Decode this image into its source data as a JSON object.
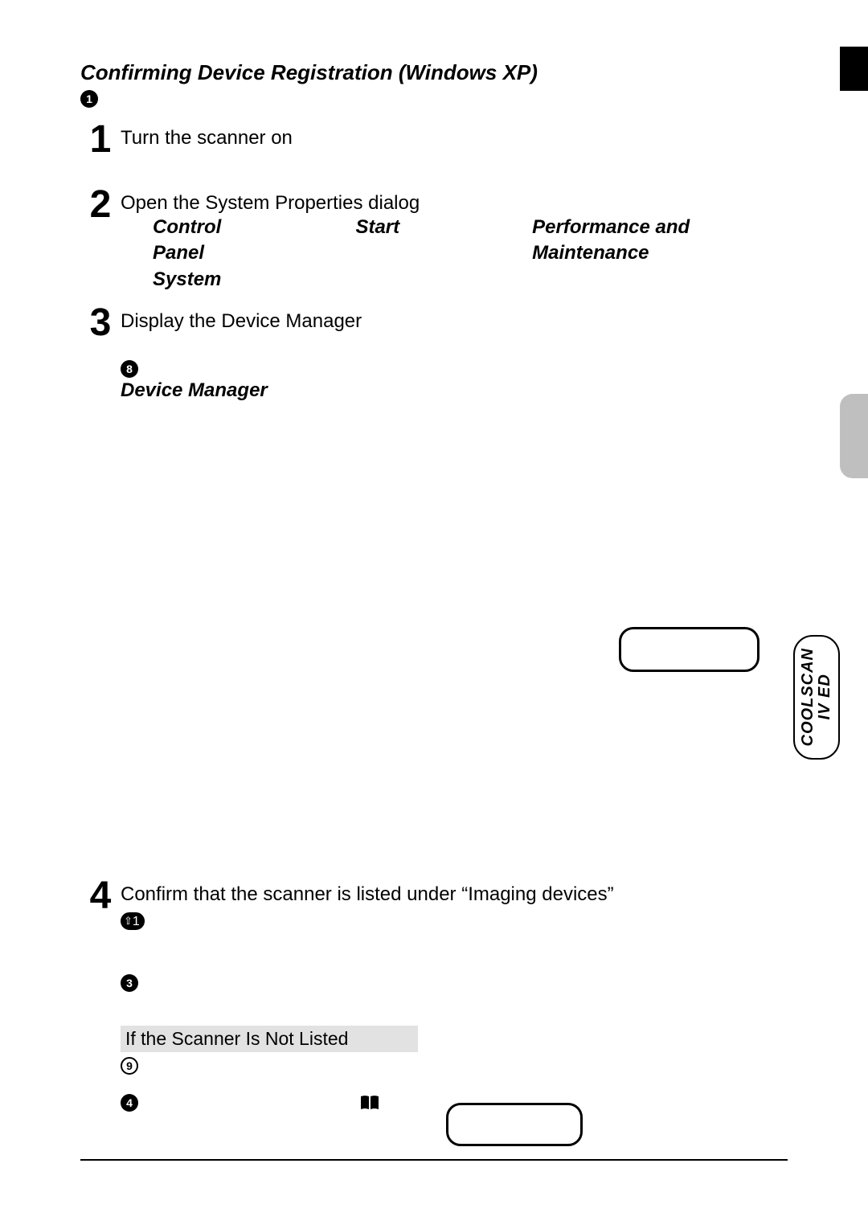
{
  "header": {
    "title": "Confirming Device Registration (Windows XP)",
    "bullet1": "1"
  },
  "steps": {
    "s1": {
      "num": "1",
      "heading": "Turn the scanner on"
    },
    "s2": {
      "num": "2",
      "heading": "Open the System Properties dialog",
      "cp": "Control Panel",
      "start": "Start",
      "perf": "Performance and Maintenance",
      "system": "System"
    },
    "s3": {
      "num": "3",
      "heading": "Display the Device Manager",
      "bullet8": "8",
      "dm": "Device Manager"
    },
    "s4": {
      "num": "4",
      "heading": "Confirm that the scanner is listed under “Imaging devices”",
      "pill_arrow": "⇧",
      "pill_num": "1",
      "bullet3": "3",
      "grey_title": "If the Scanner Is Not Listed",
      "bullet9": "9",
      "bullet4": "4"
    }
  },
  "sidebar": {
    "model_line1": "COOLSCAN",
    "model_line2": "IV ED"
  }
}
